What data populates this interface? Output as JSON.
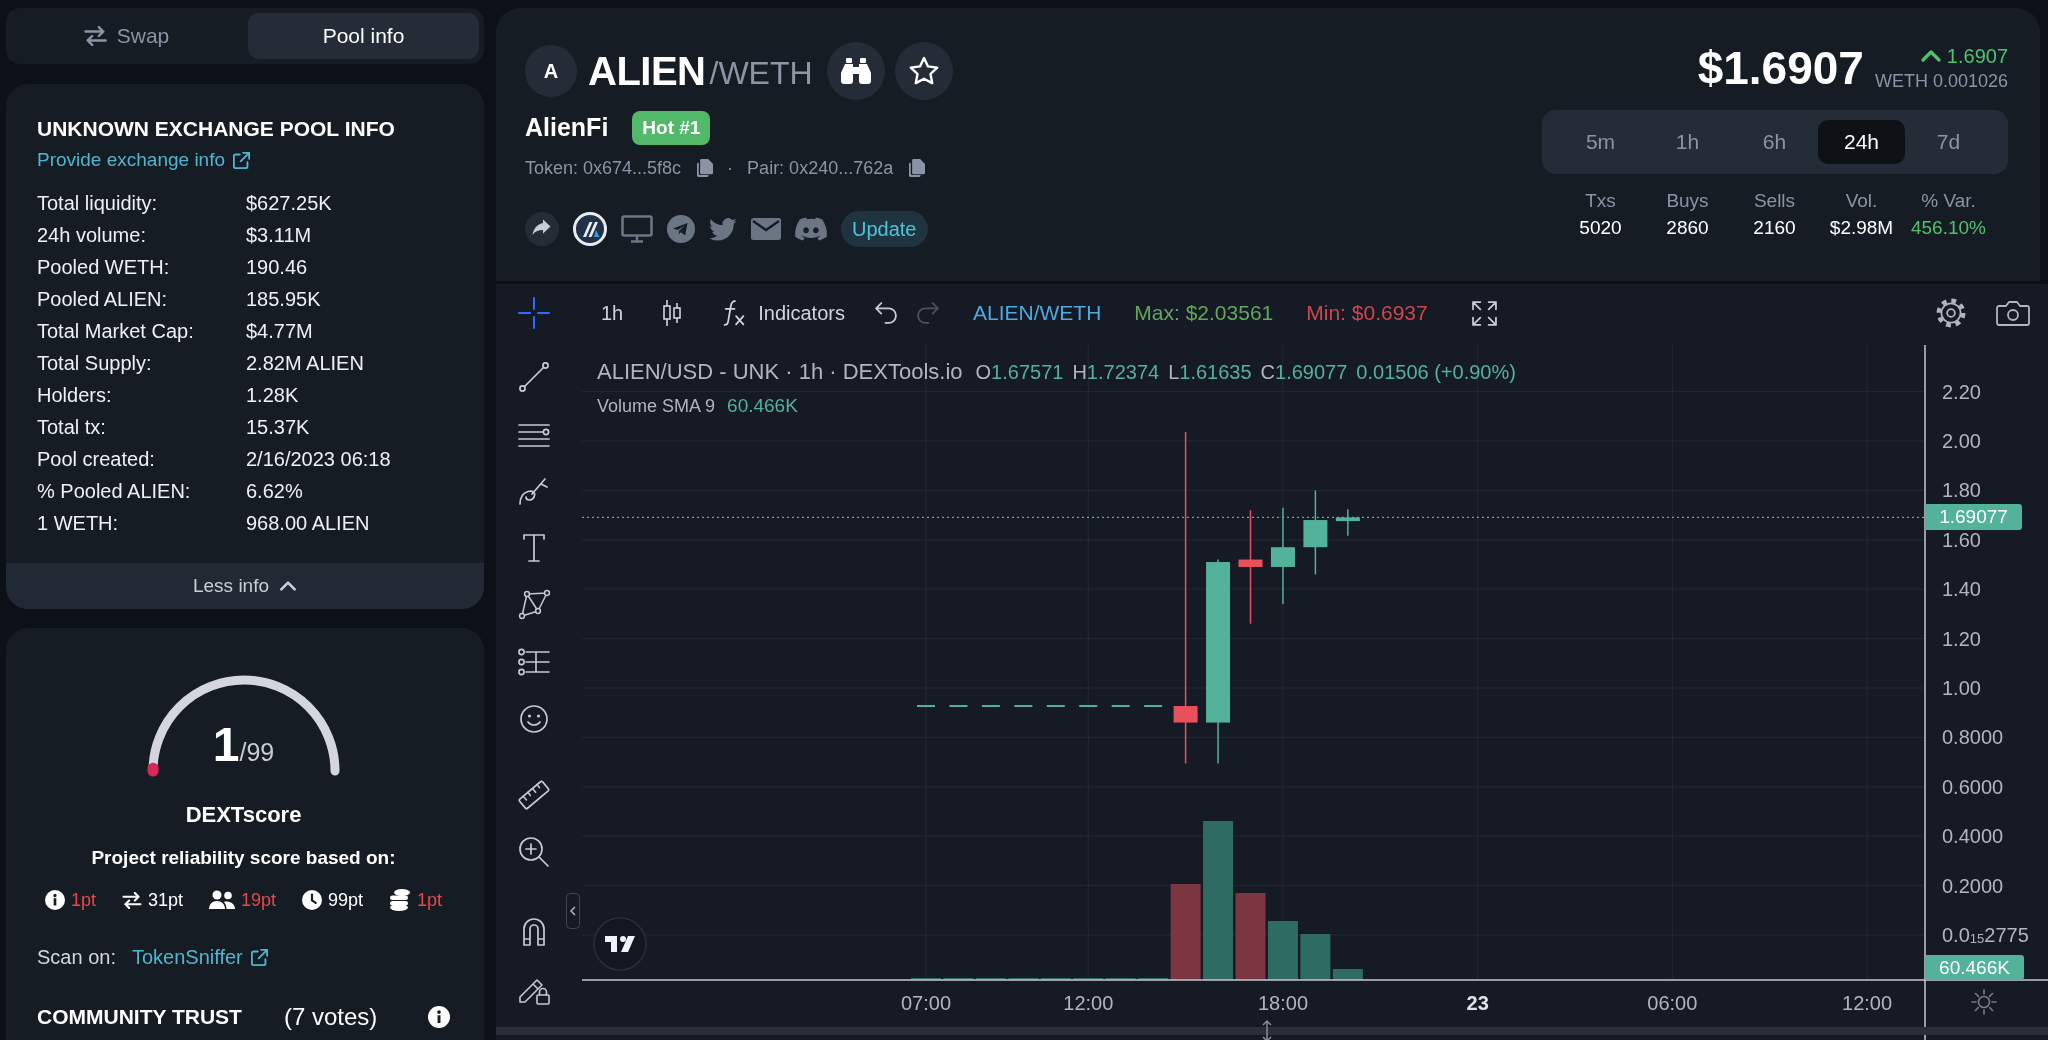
{
  "side_tabs": [
    {
      "label": "Swap",
      "selected": false
    },
    {
      "label": "Pool info",
      "selected": true
    }
  ],
  "pool_info": {
    "title": "UNKNOWN EXCHANGE POOL INFO",
    "link": "Provide exchange info",
    "rows": [
      {
        "label": "Total liquidity:",
        "value": "$627.25K"
      },
      {
        "label": "24h volume:",
        "value": "$3.11M"
      },
      {
        "label": "Pooled WETH:",
        "value": "190.46"
      },
      {
        "label": "Pooled ALIEN:",
        "value": "185.95K"
      },
      {
        "label": "Total Market Cap:",
        "value": "$4.77M"
      },
      {
        "label": "Total Supply:",
        "value": "2.82M ALIEN"
      },
      {
        "label": "Holders:",
        "value": "1.28K"
      },
      {
        "label": "Total tx:",
        "value": "15.37K"
      },
      {
        "label": "Pool created:",
        "value": "2/16/2023 06:18"
      },
      {
        "label": "% Pooled ALIEN:",
        "value": "6.62%"
      },
      {
        "label": "1 WETH:",
        "value": "968.00 ALIEN"
      }
    ],
    "toggle": {
      "label": "Less info",
      "expanded": true
    }
  },
  "dextscore": {
    "score": "1",
    "max": "/99",
    "level": 0.01,
    "title": "DEXTscore",
    "subtitle": "Project reliability score based on:",
    "factors": [
      {
        "value": "1pt",
        "color": "#e5484d"
      },
      {
        "value": "31pt",
        "color": "#ffffff"
      },
      {
        "value": "19pt",
        "color": "#e5484d"
      },
      {
        "value": "99pt",
        "color": "#ffffff"
      },
      {
        "value": "1pt",
        "color": "#e5484d"
      }
    ],
    "scan_label": "Scan on:",
    "scan_link": "TokenSniffer",
    "community": {
      "title": "COMMUNITY TRUST",
      "votes": "(7 votes)"
    }
  },
  "pair": {
    "avatar": "A",
    "symbol": "ALIEN",
    "quote": "/WETH",
    "name": "AlienFi",
    "badge": "Hot #1",
    "token_address": "Token: 0x674...5f8c",
    "separator": "·",
    "pair_address": "Pair: 0x240...762a",
    "update_button": "Update"
  },
  "price": {
    "usd": "$1.6907",
    "rising": true,
    "change": "1.6907",
    "quote_price": "WETH 0.001026"
  },
  "ranges": [
    {
      "label": "5m",
      "selected": false
    },
    {
      "label": "1h",
      "selected": false
    },
    {
      "label": "6h",
      "selected": false
    },
    {
      "label": "24h",
      "selected": true
    },
    {
      "label": "7d",
      "selected": false
    }
  ],
  "stats": [
    {
      "label": "Txs",
      "value": "5020",
      "color": "#ffffff"
    },
    {
      "label": "Buys",
      "value": "2860",
      "color": "#ffffff"
    },
    {
      "label": "Sells",
      "value": "2160",
      "color": "#ffffff"
    },
    {
      "label": "Vol.",
      "value": "$2.98M",
      "color": "#ffffff"
    },
    {
      "label": "% Var.",
      "value": "456.10%",
      "color": "#4fc26f"
    }
  ],
  "chart": {
    "toolbar": {
      "interval": "1h",
      "indicators": "Indicators",
      "undo_disabled": false,
      "redo_disabled": true,
      "symbol": "ALIEN/WETH",
      "max": "Max: $2.03561",
      "min": "Min: $0.6937"
    },
    "drawing_tools": [
      {
        "selected": true
      },
      {
        "selected": false
      },
      {
        "selected": false
      },
      {
        "selected": false
      },
      {
        "selected": false
      },
      {
        "selected": false
      },
      {
        "selected": false
      },
      {
        "selected": false
      },
      {
        "selected": false
      },
      {
        "selected": false
      },
      {
        "selected": false
      },
      {
        "selected": false
      }
    ],
    "legend": {
      "title": "ALIEN/USD - UNK · 1h · DEXTools.io",
      "ohlc": [
        {
          "key": "O",
          "value": "1.67571"
        },
        {
          "key": "H",
          "value": "1.72374"
        },
        {
          "key": "L",
          "value": "1.61635"
        },
        {
          "key": "C",
          "value": "1.69077"
        }
      ],
      "change": "0.01506 (+0.90%)",
      "volume_label": "Volume SMA 9",
      "volume_value": "60.466K"
    },
    "price_axis": [
      "2.20",
      "2.00",
      "1.80",
      "1.60",
      "1.40",
      "1.20",
      "1.00",
      "0.8000",
      "0.6000",
      "0.4000",
      "0.2000",
      "0.0$_{15}$2775"
    ],
    "last_price": "1.69077",
    "last_volume": "60.466K",
    "time_axis": [
      {
        "label": "07:00",
        "kind": "time"
      },
      {
        "label": "12:00",
        "kind": "time"
      },
      {
        "label": "18:00",
        "kind": "time"
      },
      {
        "label": "23",
        "kind": "date"
      },
      {
        "label": "06:00",
        "kind": "time"
      },
      {
        "label": "12:00",
        "kind": "time"
      }
    ]
  }
}
